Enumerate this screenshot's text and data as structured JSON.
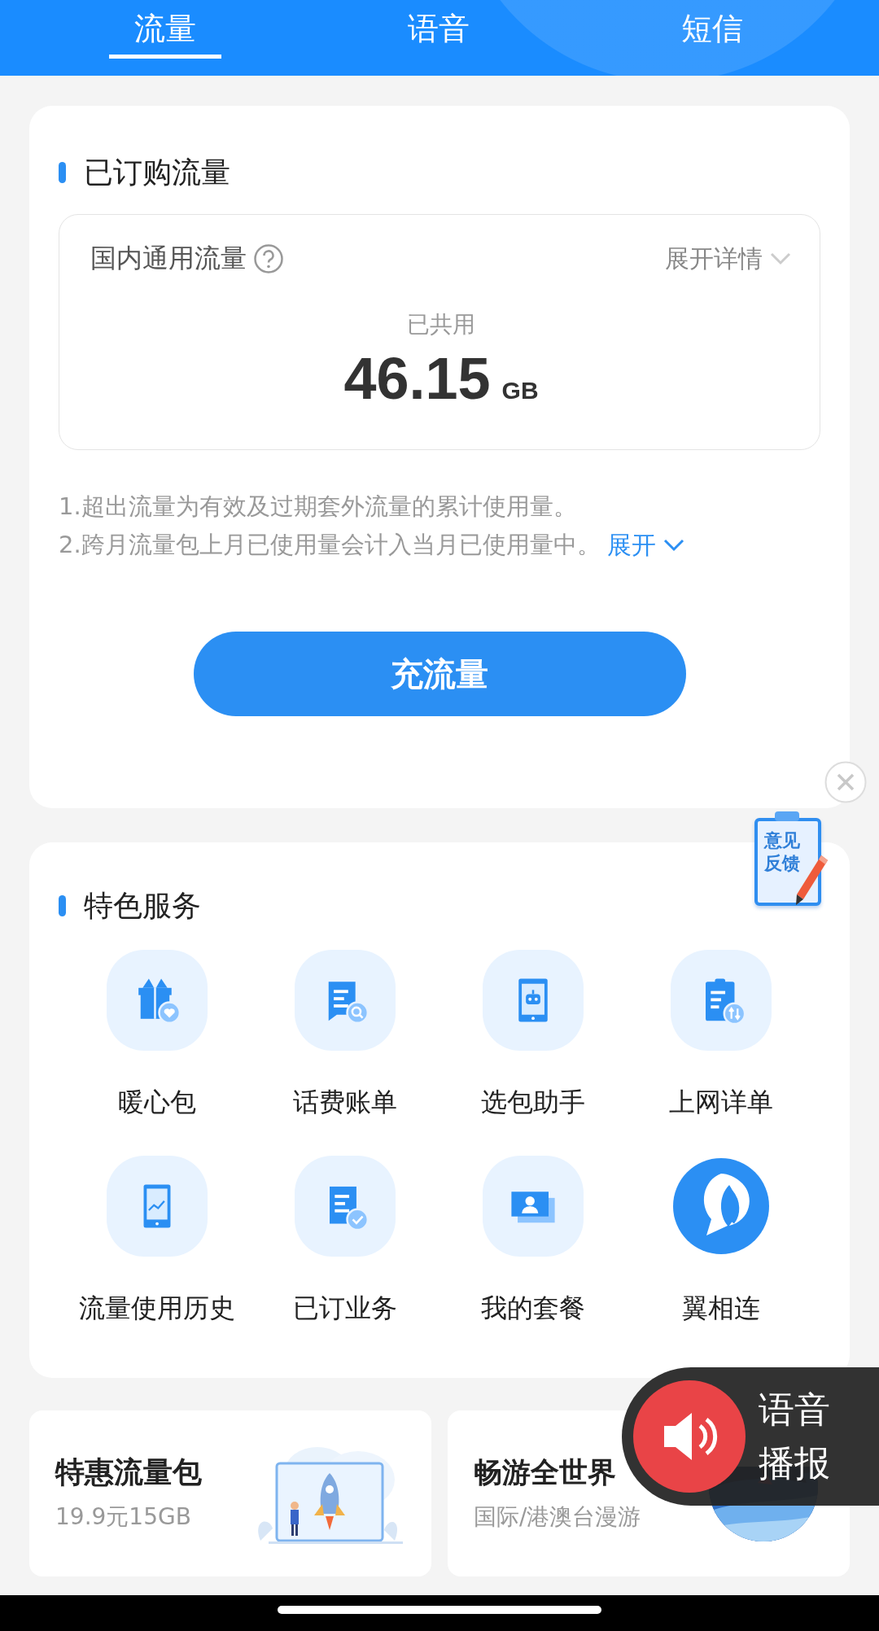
{
  "tabs": [
    {
      "label": "流量",
      "selected": true
    },
    {
      "label": "语音",
      "selected": false
    },
    {
      "label": "短信",
      "selected": false
    }
  ],
  "subscribed": {
    "title": "已订购流量",
    "pool": {
      "name": "国内通用流量",
      "details_label": "展开详情",
      "used_label": "已共用",
      "used_value": "46.15",
      "used_unit": "GB"
    },
    "notes": [
      "1.超出流量为有效及过期套外流量的累计使用量。",
      "2.跨月流量包上月已使用量会计入当月已使用量中。"
    ],
    "expand_link": "展开",
    "recharge_button": "充流量"
  },
  "feedback_badge": {
    "lines": [
      "意见",
      "反馈"
    ]
  },
  "services": {
    "title": "特色服务",
    "items": [
      {
        "label": "暖心包"
      },
      {
        "label": "话费账单"
      },
      {
        "label": "选包助手"
      },
      {
        "label": "上网详单"
      },
      {
        "label": "流量使用历史"
      },
      {
        "label": "已订业务"
      },
      {
        "label": "我的套餐"
      },
      {
        "label": "翼相连"
      }
    ]
  },
  "promos": [
    {
      "title": "特惠流量包",
      "subtitle": "19.9元15GB"
    },
    {
      "title": "畅游全世界",
      "subtitle": "国际/港澳台漫游"
    }
  ],
  "voice_broadcast": {
    "lines": [
      "语音",
      "播报"
    ]
  }
}
